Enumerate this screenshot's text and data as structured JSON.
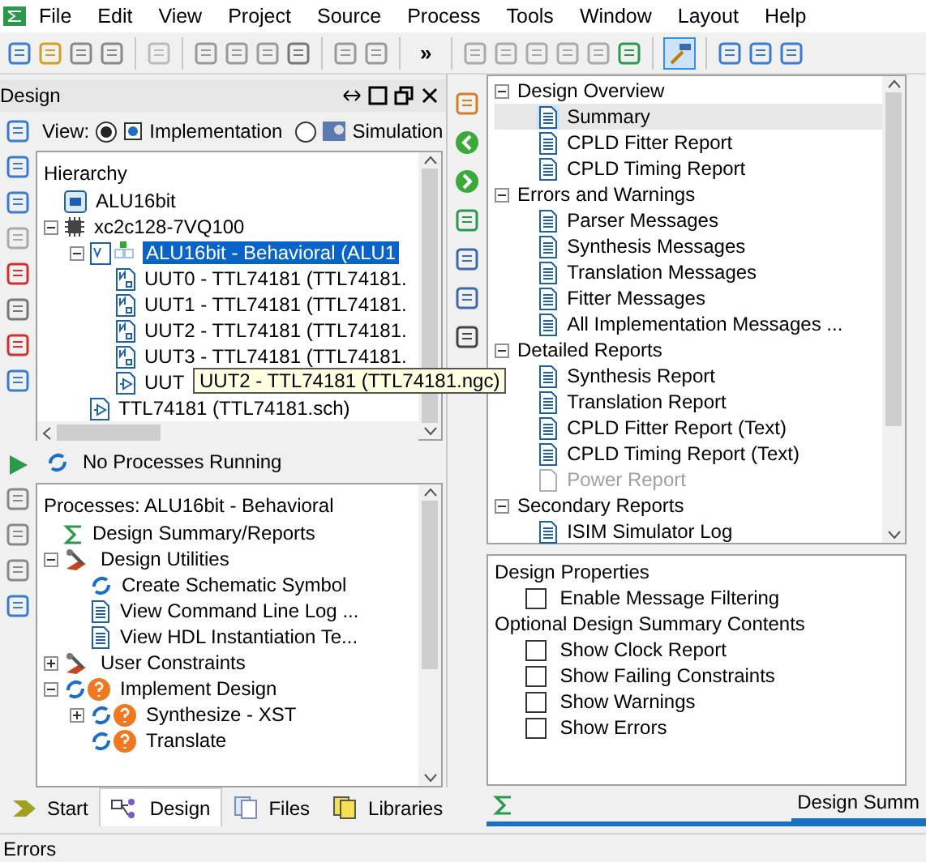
{
  "menu": [
    "File",
    "Edit",
    "View",
    "Project",
    "Source",
    "Process",
    "Tools",
    "Window",
    "Layout",
    "Help"
  ],
  "toolbar": {
    "overflow": "»"
  },
  "design_panel": {
    "title": "Design",
    "view": {
      "label": "View:",
      "options": [
        {
          "label": "Implementation",
          "selected": true
        },
        {
          "label": "Simulation",
          "selected": false
        }
      ]
    },
    "hierarchy": {
      "title": "Hierarchy",
      "items": [
        {
          "label": "ALU16bit",
          "kind": "project",
          "selected": false
        },
        {
          "label": "xc2c128-7VQ100",
          "kind": "chip",
          "selected": false,
          "expanded": true,
          "children": [
            {
              "label": "ALU16bit - Behavioral (ALU1",
              "kind": "vhdl",
              "selected": true,
              "expanded": true,
              "children": [
                {
                  "label": "UUT0 - TTL74181 (TTL74181.",
                  "kind": "ngc",
                  "selected": false
                },
                {
                  "label": "UUT1 - TTL74181 (TTL74181.",
                  "kind": "ngc",
                  "selected": false
                },
                {
                  "label": "UUT2 - TTL74181 (TTL74181.",
                  "kind": "ngc",
                  "selected": false
                },
                {
                  "label": "UUT3 - TTL74181 (TTL74181.",
                  "kind": "ngc",
                  "selected": false
                },
                {
                  "label": "UUT",
                  "kind": "sch",
                  "selected": false
                }
              ]
            },
            {
              "label": "TTL74181 (TTL74181.sch)",
              "kind": "sch",
              "selected": false
            }
          ]
        }
      ]
    },
    "tooltip": "UUT2 - TTL74181 (TTL74181.ngc)"
  },
  "processes_panel": {
    "status": "No Processes Running",
    "title": "Processes: ALU16bit - Behavioral",
    "items": [
      {
        "label": "Design Summary/Reports",
        "kind": "sigma"
      },
      {
        "label": "Design Utilities",
        "kind": "tools",
        "expanded": true,
        "children": [
          {
            "label": "Create Schematic Symbol",
            "kind": "run"
          },
          {
            "label": "View Command Line Log ...",
            "kind": "doc"
          },
          {
            "label": "View HDL Instantiation Te...",
            "kind": "doc"
          }
        ]
      },
      {
        "label": "User Constraints",
        "kind": "tools",
        "expanded": false
      },
      {
        "label": "Implement Design",
        "kind": "runq",
        "expanded": true,
        "children": [
          {
            "label": "Synthesize - XST",
            "kind": "runq",
            "expanded": false
          },
          {
            "label": "Translate",
            "kind": "runq"
          }
        ]
      }
    ]
  },
  "bottom_tabs": [
    {
      "label": "Start",
      "kind": "arrow",
      "selected": false
    },
    {
      "label": "Design",
      "kind": "design",
      "selected": true
    },
    {
      "label": "Files",
      "kind": "files",
      "selected": false
    },
    {
      "label": "Libraries",
      "kind": "libs",
      "selected": false
    }
  ],
  "reports": [
    {
      "label": "Design Overview",
      "expanded": true,
      "children": [
        {
          "label": "Summary",
          "selected": true,
          "disabled": false
        },
        {
          "label": "CPLD Fitter Report",
          "selected": false,
          "disabled": false
        },
        {
          "label": "CPLD Timing Report",
          "selected": false,
          "disabled": false
        }
      ]
    },
    {
      "label": "Errors and Warnings",
      "expanded": true,
      "children": [
        {
          "label": "Parser Messages",
          "selected": false,
          "disabled": false
        },
        {
          "label": "Synthesis Messages",
          "selected": false,
          "disabled": false
        },
        {
          "label": "Translation Messages",
          "selected": false,
          "disabled": false
        },
        {
          "label": "Fitter Messages",
          "selected": false,
          "disabled": false
        },
        {
          "label": "All Implementation Messages ...",
          "selected": false,
          "disabled": false
        }
      ]
    },
    {
      "label": "Detailed Reports",
      "expanded": true,
      "children": [
        {
          "label": "Synthesis Report",
          "selected": false,
          "disabled": false
        },
        {
          "label": "Translation Report",
          "selected": false,
          "disabled": false
        },
        {
          "label": "CPLD Fitter Report (Text)",
          "selected": false,
          "disabled": false
        },
        {
          "label": "CPLD Timing Report (Text)",
          "selected": false,
          "disabled": false
        },
        {
          "label": "Power Report",
          "selected": false,
          "disabled": true
        }
      ]
    },
    {
      "label": "Secondary Reports",
      "expanded": true,
      "children": [
        {
          "label": "ISIM Simulator Log",
          "selected": false,
          "disabled": false
        }
      ]
    }
  ],
  "properties": [
    {
      "label": "Design Properties",
      "options": [
        {
          "label": "Enable Message Filtering",
          "checked": false
        }
      ]
    },
    {
      "label": "Optional Design Summary Contents",
      "options": [
        {
          "label": "Show Clock Report",
          "checked": false
        },
        {
          "label": "Show Failing Constraints",
          "checked": false
        },
        {
          "label": "Show Warnings",
          "checked": false
        },
        {
          "label": "Show Errors",
          "checked": false
        }
      ]
    }
  ],
  "editor_tab": {
    "label": "Design Summ",
    "selected": true
  },
  "status_bar": "Errors"
}
